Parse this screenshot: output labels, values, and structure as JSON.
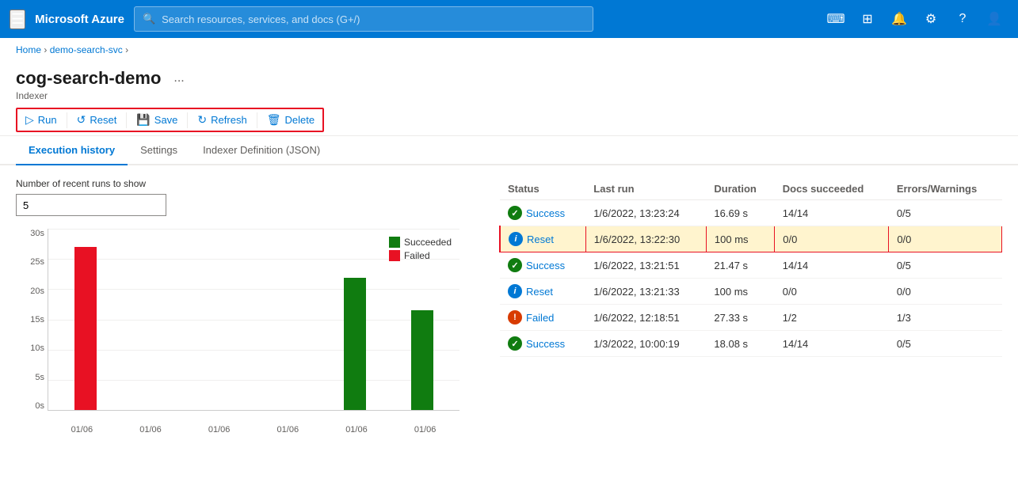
{
  "topnav": {
    "logo": "Microsoft Azure",
    "search_placeholder": "Search resources, services, and docs (G+/)"
  },
  "breadcrumb": {
    "home": "Home",
    "service": "demo-search-svc",
    "current": ""
  },
  "page": {
    "title": "cog-search-demo",
    "subtitle": "Indexer",
    "ellipsis": "..."
  },
  "toolbar": {
    "run": "Run",
    "reset": "Reset",
    "save": "Save",
    "refresh": "Refresh",
    "delete": "Delete"
  },
  "tabs": [
    {
      "id": "execution-history",
      "label": "Execution history",
      "active": true
    },
    {
      "id": "settings",
      "label": "Settings",
      "active": false
    },
    {
      "id": "indexer-definition",
      "label": "Indexer Definition (JSON)",
      "active": false
    }
  ],
  "runs_label": "Number of recent runs to show",
  "runs_value": "5",
  "chart": {
    "y_labels": [
      "30s",
      "25s",
      "20s",
      "15s",
      "10s",
      "5s",
      "0s"
    ],
    "x_labels": [
      "01/06",
      "01/06",
      "01/06",
      "01/06",
      "01/06",
      "01/06"
    ],
    "bars": [
      {
        "height_pct": 90,
        "color": "#e81123"
      },
      {
        "height_pct": 0,
        "color": "#107c10"
      },
      {
        "height_pct": 0,
        "color": "#107c10"
      },
      {
        "height_pct": 0,
        "color": "#107c10"
      },
      {
        "height_pct": 73,
        "color": "#107c10"
      },
      {
        "height_pct": 55,
        "color": "#107c10"
      }
    ],
    "legend": [
      {
        "label": "Succeeded",
        "color": "#107c10"
      },
      {
        "label": "Failed",
        "color": "#e81123"
      }
    ]
  },
  "table": {
    "headers": [
      "Status",
      "Last run",
      "Duration",
      "Docs succeeded",
      "Errors/Warnings"
    ],
    "rows": [
      {
        "status": "Success",
        "status_type": "success",
        "last_run": "1/6/2022, 13:23:24",
        "duration": "16.69 s",
        "docs": "14/14",
        "errors": "0/5",
        "selected": false
      },
      {
        "status": "Reset",
        "status_type": "info",
        "last_run": "1/6/2022, 13:22:30",
        "duration": "100 ms",
        "docs": "0/0",
        "errors": "0/0",
        "selected": true
      },
      {
        "status": "Success",
        "status_type": "success",
        "last_run": "1/6/2022, 13:21:51",
        "duration": "21.47 s",
        "docs": "14/14",
        "errors": "0/5",
        "selected": false
      },
      {
        "status": "Reset",
        "status_type": "info",
        "last_run": "1/6/2022, 13:21:33",
        "duration": "100 ms",
        "docs": "0/0",
        "errors": "0/0",
        "selected": false
      },
      {
        "status": "Failed",
        "status_type": "failed",
        "last_run": "1/6/2022, 12:18:51",
        "duration": "27.33 s",
        "docs": "1/2",
        "errors": "1/3",
        "selected": false
      },
      {
        "status": "Success",
        "status_type": "success",
        "last_run": "1/3/2022, 10:00:19",
        "duration": "18.08 s",
        "docs": "14/14",
        "errors": "0/5",
        "selected": false
      }
    ]
  }
}
